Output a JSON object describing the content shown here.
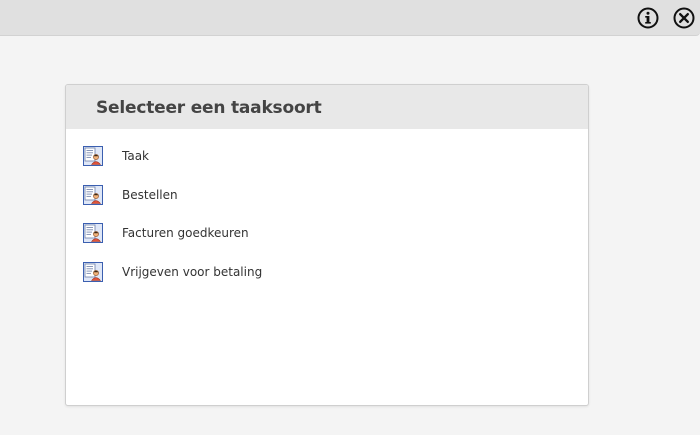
{
  "toolbar": {
    "info_icon": "info-circle-icon",
    "close_icon": "close-circle-icon"
  },
  "panel": {
    "title": "Selecteer een taaksoort",
    "items": [
      {
        "label": "Taak",
        "icon": "task-document-person-icon"
      },
      {
        "label": "Bestellen",
        "icon": "task-document-person-icon"
      },
      {
        "label": "Facturen goedkeuren",
        "icon": "task-document-person-icon"
      },
      {
        "label": "Vrijgeven voor betaling",
        "icon": "task-document-person-icon"
      }
    ]
  },
  "colors": {
    "background": "#f4f4f4",
    "topbar": "#e0e0e0",
    "panel_header": "#e8e8e8",
    "panel_body": "#ffffff",
    "icon_border": "#3b5fb0"
  }
}
